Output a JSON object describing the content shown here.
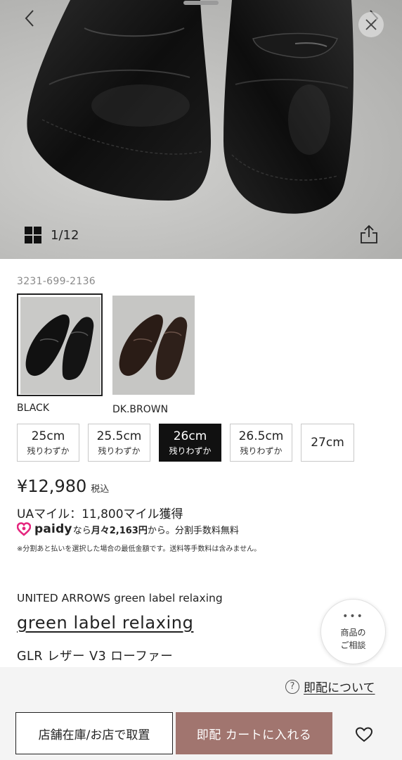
{
  "gallery": {
    "counter": "1/12",
    "colors": {
      "background": "#bcbcba",
      "shoe": "#141414"
    }
  },
  "product": {
    "code": "3231-699-2136",
    "brand_line": "UNITED ARROWS green label relaxing",
    "brand_link": "green label relaxing",
    "name": "GLR レザー V3 ローファー"
  },
  "colors": [
    {
      "label": "BLACK",
      "selected": true
    },
    {
      "label": "DK.BROWN",
      "selected": false
    }
  ],
  "sizes": [
    {
      "size": "25cm",
      "stock": "残りわずか",
      "selected": false
    },
    {
      "size": "25.5cm",
      "stock": "残りわずか",
      "selected": false
    },
    {
      "size": "26cm",
      "stock": "残りわずか",
      "selected": true
    },
    {
      "size": "26.5cm",
      "stock": "残りわずか",
      "selected": false
    },
    {
      "size": "27cm",
      "stock": "",
      "selected": false
    }
  ],
  "price": {
    "amount": "¥12,980",
    "tax": "税込"
  },
  "miles": "UAマイル：11,800マイル獲得",
  "paidy": {
    "brand": "paidy",
    "nara": "なら",
    "monthly": "月々2,163円",
    "rest": "から。分割手数料無料",
    "accent": "#e5257e"
  },
  "note": "※分割あと払いを選択した場合の最低金額です。送料等手数料は含みません。",
  "consult": {
    "line1": "商品の",
    "line2": "ご相談"
  },
  "bottom": {
    "soku_info": "即配について",
    "store_button": "店舗在庫/お店で取置",
    "cart_button": "即配 カートに入れる",
    "cart_color": "#a1756f"
  }
}
